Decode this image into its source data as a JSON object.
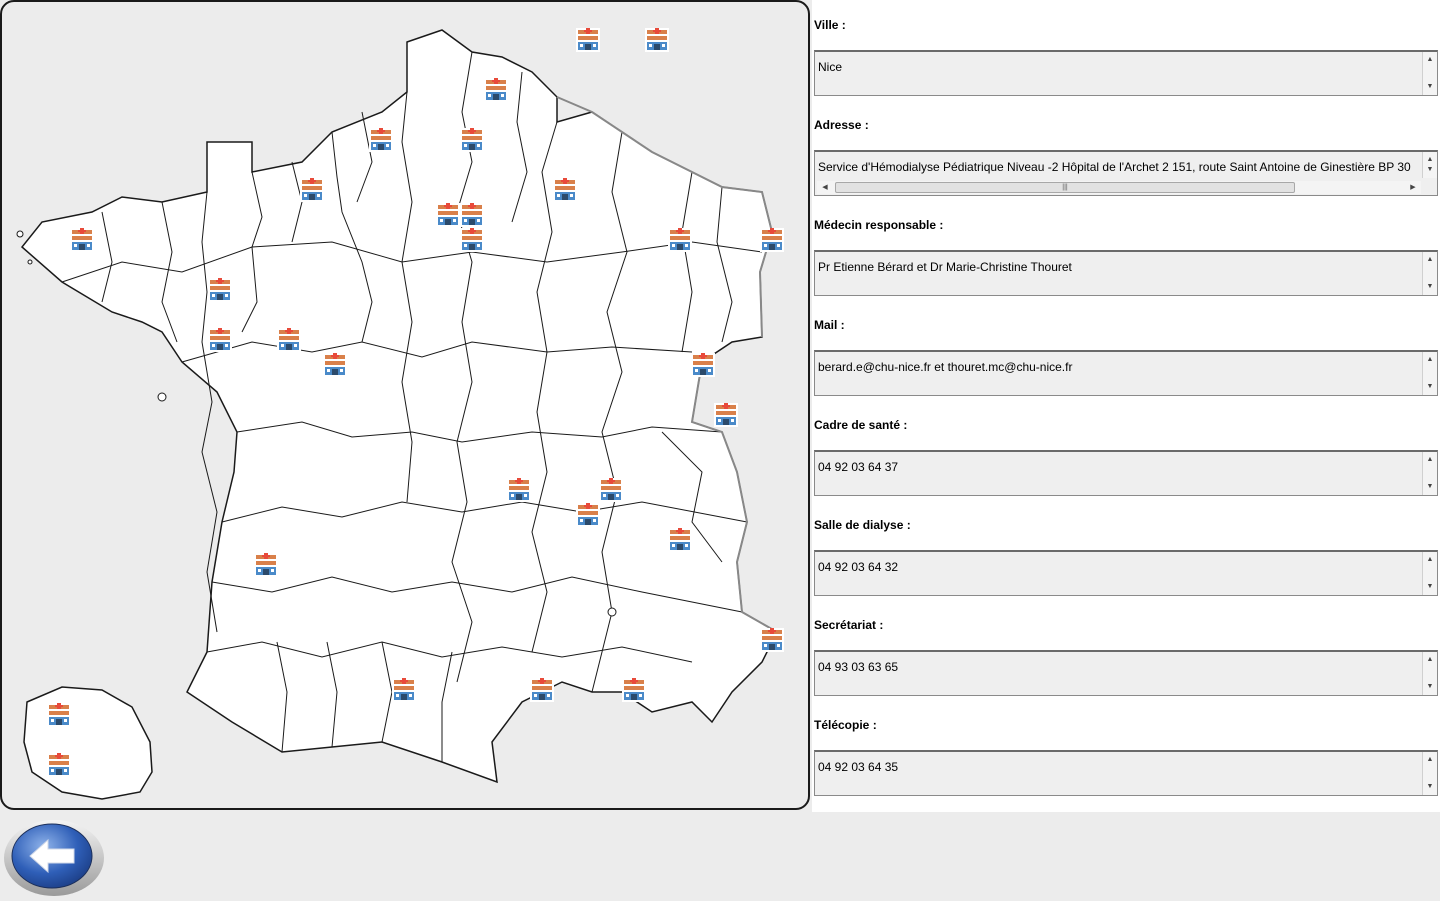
{
  "map": {
    "icon": "hospital-icon",
    "outline_color": "#1a1a1a",
    "land_color": "#ffffff",
    "markers_count_label": ""
  },
  "fields": [
    {
      "key": "ville",
      "label": "Ville :",
      "value": "Nice",
      "scroll": "vertical"
    },
    {
      "key": "adresse",
      "label": "Adresse :",
      "value": "Service d'Hémodialyse Pédiatrique Niveau -2 Hôpital de l'Archet 2 151, route Saint Antoine de Ginestière BP 30",
      "scroll": "both"
    },
    {
      "key": "medecin",
      "label": "Médecin responsable :",
      "value": "Pr Etienne Bérard et  Dr Marie-Christine Thouret",
      "scroll": "vertical"
    },
    {
      "key": "mail",
      "label": "Mail :",
      "value": "berard.e@chu-nice.fr et thouret.mc@chu-nice.fr",
      "scroll": "vertical"
    },
    {
      "key": "cadre",
      "label": "Cadre de santé :",
      "value": "04 92 03 64 37",
      "scroll": "vertical"
    },
    {
      "key": "salle",
      "label": "Salle de dialyse :",
      "value": "04 92 03 64 32",
      "scroll": "vertical"
    },
    {
      "key": "secretariat",
      "label": "Secrétariat :",
      "value": "04 93 03 63 65",
      "scroll": "vertical"
    },
    {
      "key": "telecopie",
      "label": "Télécopie :",
      "value": "04 92 03 64 35",
      "scroll": "vertical"
    }
  ],
  "back_button": {
    "icon": "back-arrow-icon"
  },
  "colors": {
    "field_bg": "#efefef",
    "marker_orange": "#d9804a",
    "marker_blue": "#4a8ac9"
  }
}
